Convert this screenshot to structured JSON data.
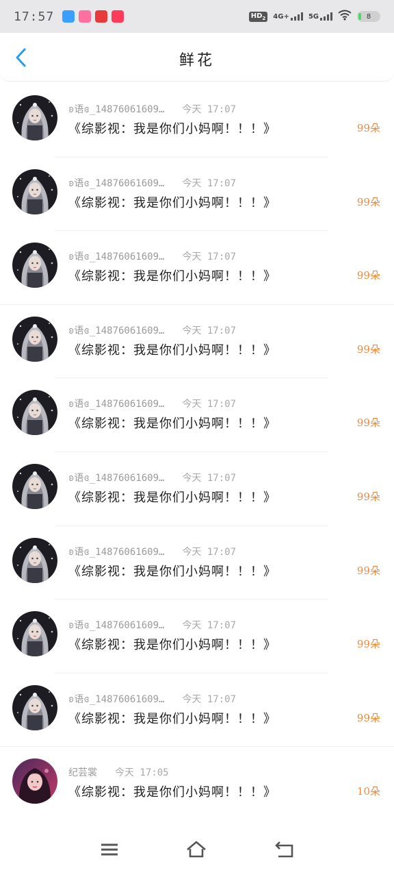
{
  "status_bar": {
    "time": "17:57",
    "apps": [
      {
        "icon": "app-blue-icon",
        "color": "#3aa0ff",
        "label": "App"
      },
      {
        "icon": "app-pink-icon",
        "color": "#ff6fa0",
        "label": "Kids"
      },
      {
        "icon": "app-red-icon",
        "color": "#e83a3a",
        "label": "Red"
      },
      {
        "icon": "app-shop-icon",
        "color": "#ff3b5c",
        "label": "SALE"
      }
    ],
    "hd": "HD",
    "hd_sub": "2",
    "network_4g": "4G+",
    "network_5g": "5G",
    "battery": "8"
  },
  "header": {
    "back_icon": "chevron-left-icon",
    "title": "鲜花",
    "accent": "#2b9ce8"
  },
  "list": {
    "items": [
      {
        "user": "ʚ语ɞ_14876061609…",
        "time": "今天 17:07",
        "message": "《综影视：我是你们小妈啊！！！》",
        "amount": "99朵"
      },
      {
        "user": "ʚ语ɞ_14876061609…",
        "time": "今天 17:07",
        "message": "《综影视：我是你们小妈啊！！！》",
        "amount": "99朵"
      },
      {
        "user": "ʚ语ɞ_14876061609…",
        "time": "今天 17:07",
        "message": "《综影视：我是你们小妈啊！！！》",
        "amount": "99朵"
      },
      {
        "user": "ʚ语ɞ_14876061609…",
        "time": "今天 17:07",
        "message": "《综影视：我是你们小妈啊！！！》",
        "amount": "99朵"
      },
      {
        "user": "ʚ语ɞ_14876061609…",
        "time": "今天 17:07",
        "message": "《综影视：我是你们小妈啊！！！》",
        "amount": "99朵"
      },
      {
        "user": "ʚ语ɞ_14876061609…",
        "time": "今天 17:07",
        "message": "《综影视：我是你们小妈啊！！！》",
        "amount": "99朵"
      },
      {
        "user": "ʚ语ɞ_14876061609…",
        "time": "今天 17:07",
        "message": "《综影视：我是你们小妈啊！！！》",
        "amount": "99朵"
      },
      {
        "user": "ʚ语ɞ_14876061609…",
        "time": "今天 17:07",
        "message": "《综影视：我是你们小妈啊！！！》",
        "amount": "99朵"
      },
      {
        "user": "ʚ语ɞ_14876061609…",
        "time": "今天 17:07",
        "message": "《综影视：我是你们小妈啊！！！》",
        "amount": "99朵"
      },
      {
        "user": "纪芸裳",
        "time": "今天 17:05",
        "message": "《综影视：我是你们小妈啊！！！》",
        "amount": "10朵"
      }
    ],
    "amount_color": "#f0883a"
  },
  "nav_bar": {
    "menu_icon": "menu-icon",
    "home_icon": "home-icon",
    "back_icon": "back-icon"
  }
}
